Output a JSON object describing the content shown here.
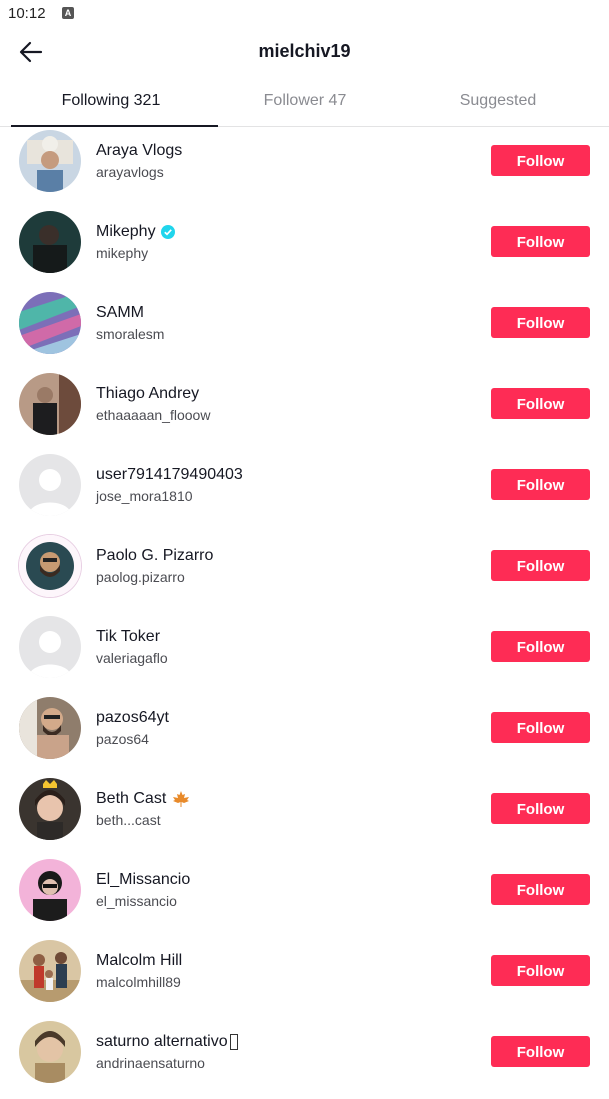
{
  "status_bar": {
    "time": "10:12",
    "app_icon": "A"
  },
  "header": {
    "title": "mielchiv19",
    "back_icon": "arrow-left-icon"
  },
  "tabs": [
    {
      "label": "Following 321",
      "active": true
    },
    {
      "label": "Follower 47",
      "active": false
    },
    {
      "label": "Suggested",
      "active": false
    }
  ],
  "colors": {
    "accent": "#fe2c55",
    "text": "#161823",
    "muted": "#8a8b91",
    "verified": "#20d5ec"
  },
  "users": [
    {
      "name": "Araya Vlogs",
      "handle": "arayavlogs",
      "button": "Follow"
    },
    {
      "name": "Mikephy",
      "handle": "mikephy",
      "button": "Follow",
      "verified": true
    },
    {
      "name": "SAMM",
      "handle": "smoralesm",
      "button": "Follow"
    },
    {
      "name": "Thiago Andrey",
      "handle": "ethaaaaan_flooow",
      "button": "Follow"
    },
    {
      "name": "user7914179490403",
      "handle": "jose_mora1810",
      "button": "Follow"
    },
    {
      "name": "Paolo G. Pizarro",
      "handle": "paolog.pizarro",
      "button": "Follow"
    },
    {
      "name": "Tik Toker",
      "handle": "valeriagaflo",
      "button": "Follow"
    },
    {
      "name": "pazos64yt",
      "handle": "pazos64",
      "button": "Follow"
    },
    {
      "name": "Beth Cast",
      "handle": "beth...cast",
      "button": "Follow",
      "emoji": "maple-leaf-icon"
    },
    {
      "name": "El_Missancio",
      "handle": "el_missancio",
      "button": "Follow"
    },
    {
      "name": "Malcolm Hill",
      "handle": "malcolmhill89",
      "button": "Follow"
    },
    {
      "name": "saturno alternativo",
      "handle": "andrinaensaturno",
      "button": "Follow"
    }
  ]
}
